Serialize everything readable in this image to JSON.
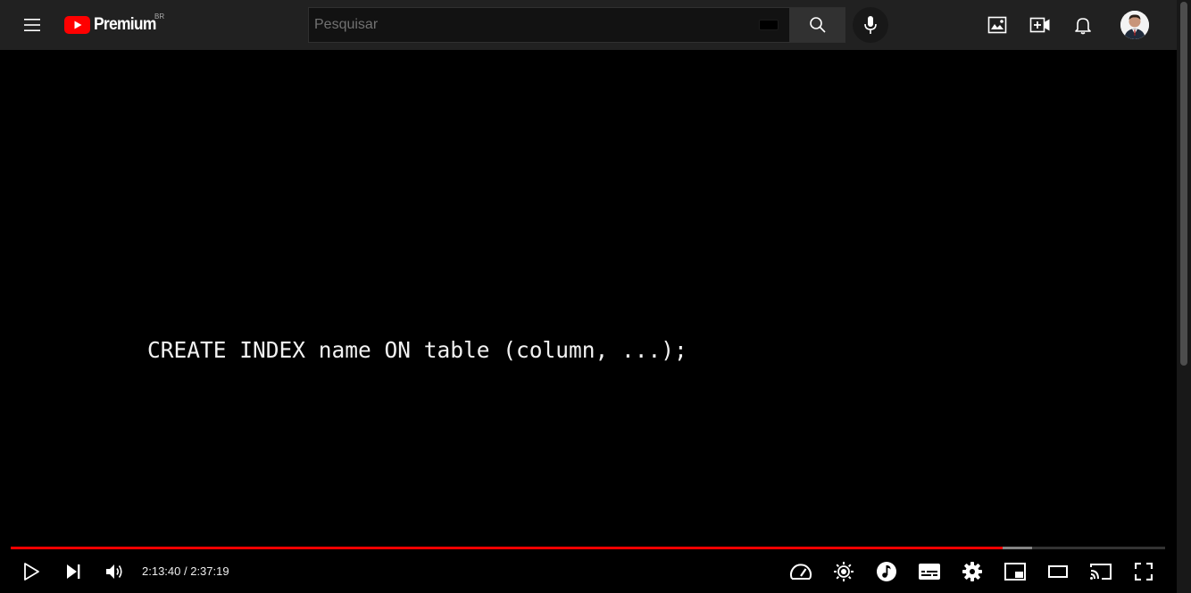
{
  "masthead": {
    "logo_text": "Premium",
    "country_code": "BR",
    "search_placeholder": "Pesquisar",
    "icons": [
      "menu-icon",
      "search-icon",
      "mic-icon",
      "image-icon",
      "create-icon",
      "notifications-icon"
    ]
  },
  "video": {
    "code_text": "CREATE INDEX name ON table (column, ...);"
  },
  "player": {
    "current_time": "2:13:40",
    "separator": " / ",
    "duration": "2:37:19",
    "played_fraction": 0.859,
    "buffered_fraction": 0.885,
    "accent_color": "#ff0000",
    "controls": [
      "play-icon",
      "next-icon",
      "volume-icon",
      "speed-icon",
      "ambient-icon",
      "music-icon",
      "subtitles-icon",
      "settings-icon",
      "miniplayer-icon",
      "theater-icon",
      "cast-icon",
      "fullscreen-icon"
    ]
  }
}
